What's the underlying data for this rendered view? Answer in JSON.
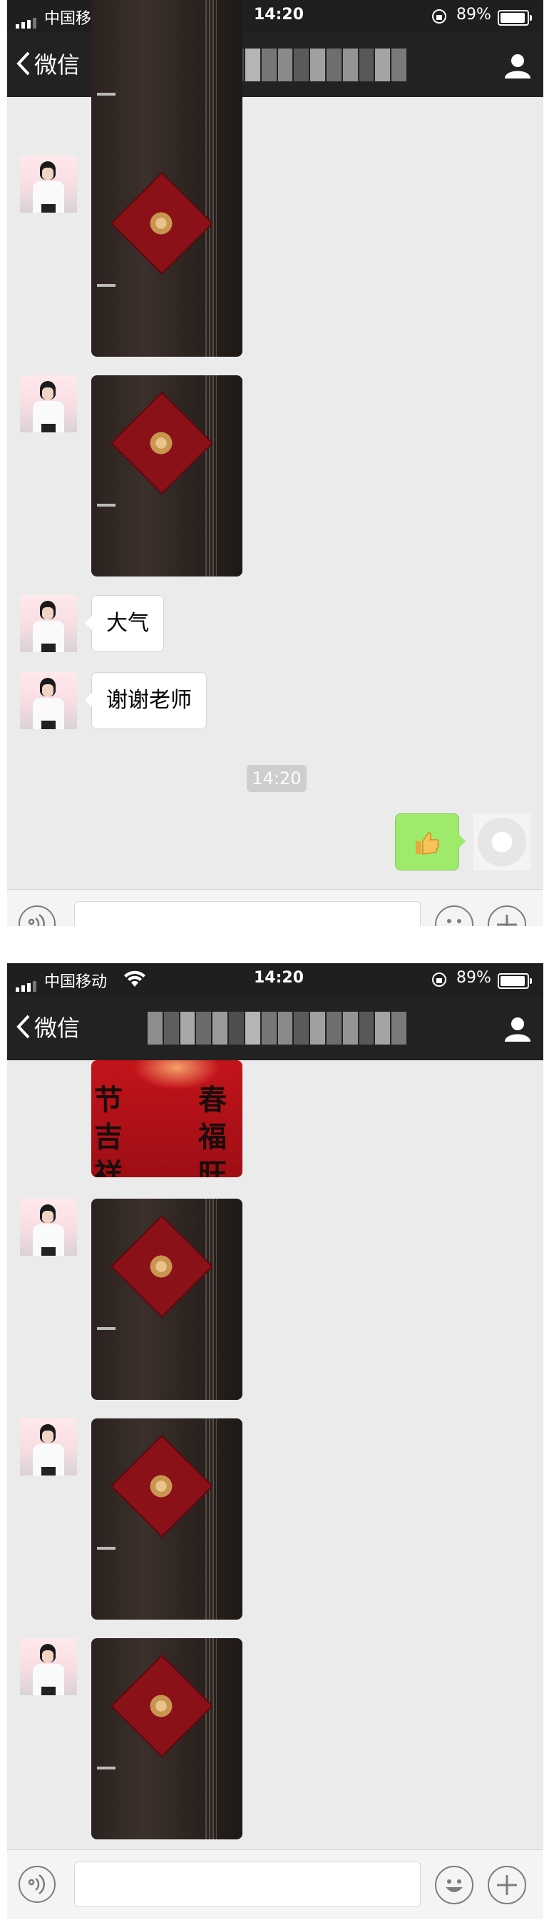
{
  "status_bar": {
    "carrier": "中国移动",
    "time": "14:20",
    "battery": "89%"
  },
  "nav": {
    "back_label": "微信",
    "title_obscured": true
  },
  "screens": [
    {
      "messages": [
        {
          "type": "image",
          "from": "other",
          "scene": "door-fu"
        },
        {
          "type": "image",
          "from": "other",
          "scene": "door-fu"
        },
        {
          "type": "image",
          "from": "other",
          "scene": "door-fu"
        },
        {
          "type": "text",
          "from": "other",
          "text": "大气"
        },
        {
          "type": "text",
          "from": "other",
          "text": "谢谢老师"
        },
        {
          "type": "timestamp",
          "text": "14:20"
        },
        {
          "type": "sticker",
          "from": "me",
          "icon": "thumbs-up-icon"
        }
      ]
    },
    {
      "messages": [
        {
          "type": "image",
          "from": "other",
          "scene": "red-couplets",
          "couplet_left": "节吉祥",
          "couplet_right": "春福旺"
        },
        {
          "type": "image",
          "from": "other",
          "scene": "door-fu"
        },
        {
          "type": "image",
          "from": "other",
          "scene": "door-fu"
        },
        {
          "type": "image",
          "from": "other",
          "scene": "door-fu"
        }
      ]
    }
  ],
  "colors": {
    "nav_bg": "#222222",
    "chat_bg": "#ebebeb",
    "out_bubble": "#9eea6a",
    "timestamp_bg": "#cecece"
  }
}
